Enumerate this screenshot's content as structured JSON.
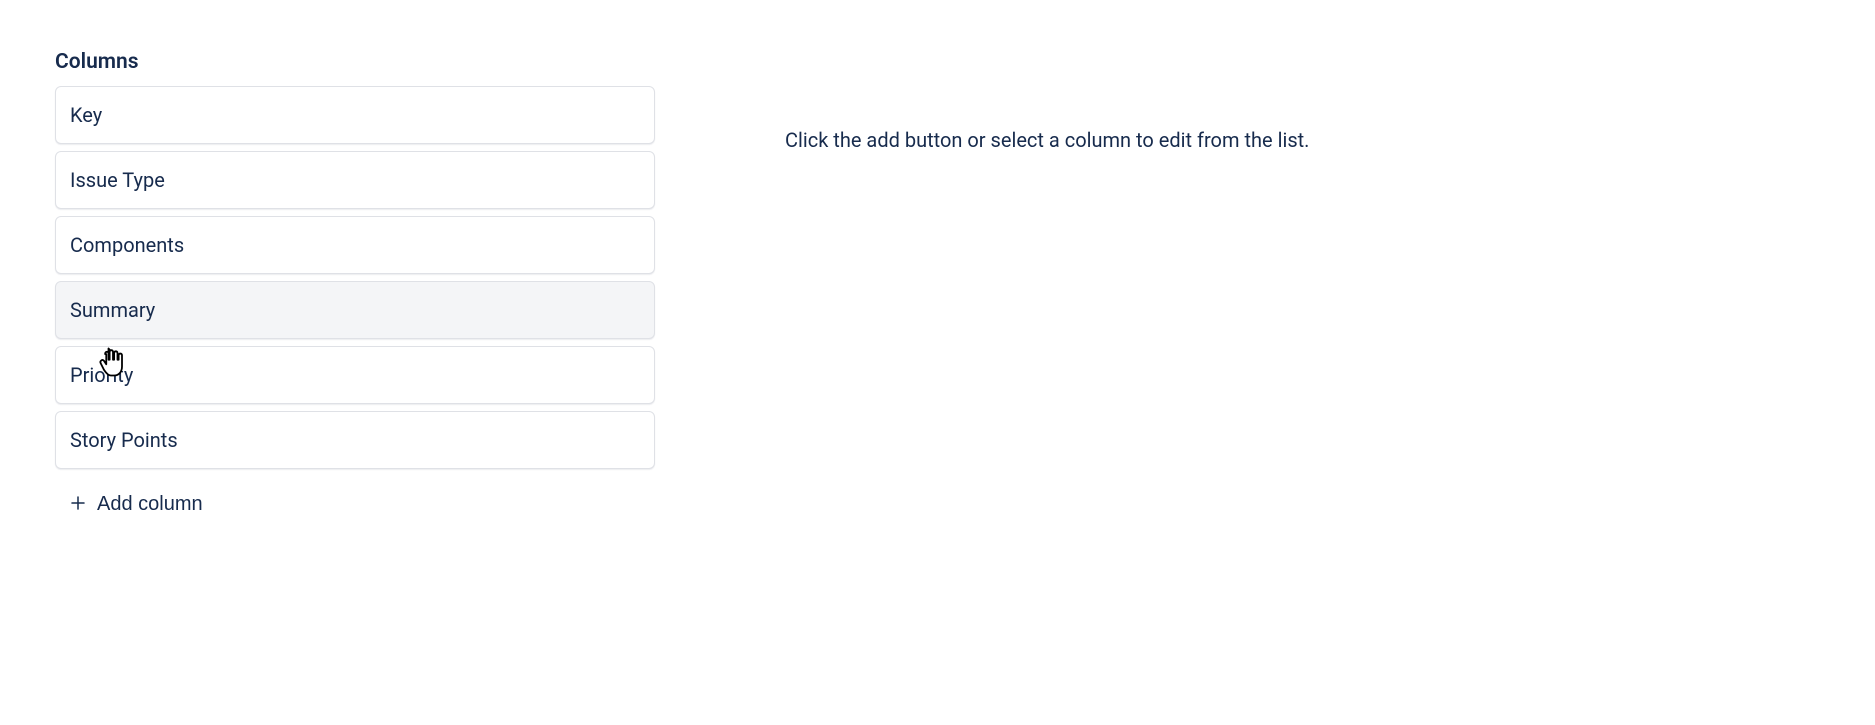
{
  "section": {
    "title": "Columns"
  },
  "columns": [
    {
      "label": "Key"
    },
    {
      "label": "Issue Type"
    },
    {
      "label": "Components"
    },
    {
      "label": "Summary"
    },
    {
      "label": "Priority"
    },
    {
      "label": "Story Points"
    }
  ],
  "addButton": {
    "label": "Add column"
  },
  "instruction": {
    "text": "Click the add button or select a column to edit from the list."
  }
}
